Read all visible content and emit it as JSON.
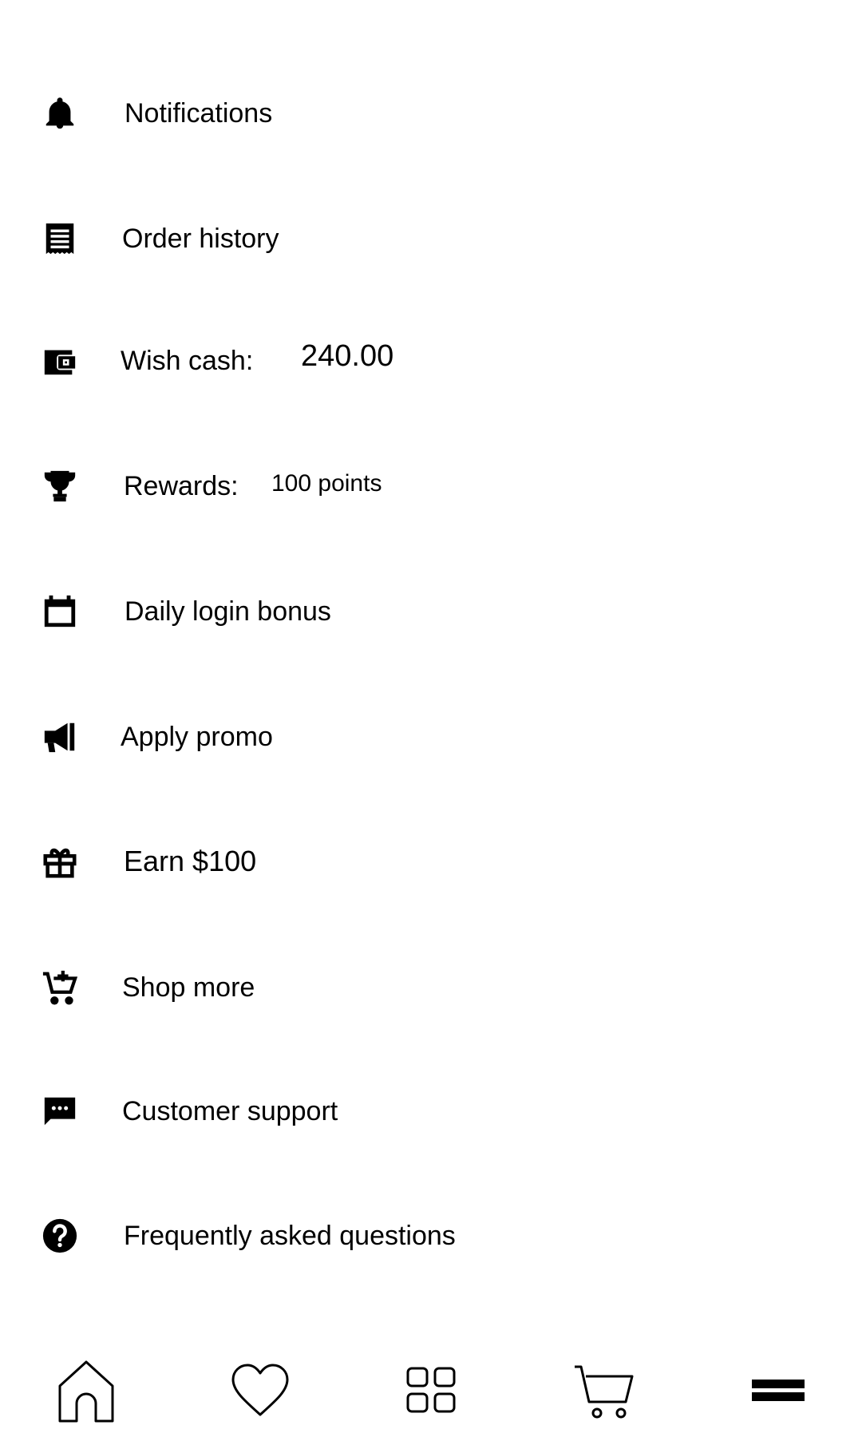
{
  "menu": {
    "notifications": {
      "label": "Notifications",
      "icon": "bell-icon"
    },
    "order_history": {
      "label": "Order history",
      "icon": "receipt-icon"
    },
    "wish_cash": {
      "label": "Wish cash:",
      "value": "240.00",
      "icon": "wallet-icon"
    },
    "rewards": {
      "label": "Rewards:",
      "value": "100 points",
      "icon": "trophy-icon"
    },
    "daily_login": {
      "label": "Daily login bonus",
      "icon": "calendar-icon"
    },
    "apply_promo": {
      "label": "Apply promo",
      "icon": "megaphone-icon"
    },
    "earn": {
      "label": "Earn $100",
      "icon": "gift-icon"
    },
    "shop_more": {
      "label": "Shop more",
      "icon": "cart-plus-icon"
    },
    "support": {
      "label": "Customer support",
      "icon": "chat-icon"
    },
    "faq": {
      "label": "Frequently asked questions",
      "icon": "help-circle-icon"
    }
  },
  "bottom_nav": [
    {
      "name": "home",
      "icon": "home-icon"
    },
    {
      "name": "wishlist",
      "icon": "heart-icon"
    },
    {
      "name": "categories",
      "icon": "grid-icon"
    },
    {
      "name": "cart",
      "icon": "cart-icon"
    },
    {
      "name": "menu",
      "icon": "menu-icon"
    }
  ]
}
